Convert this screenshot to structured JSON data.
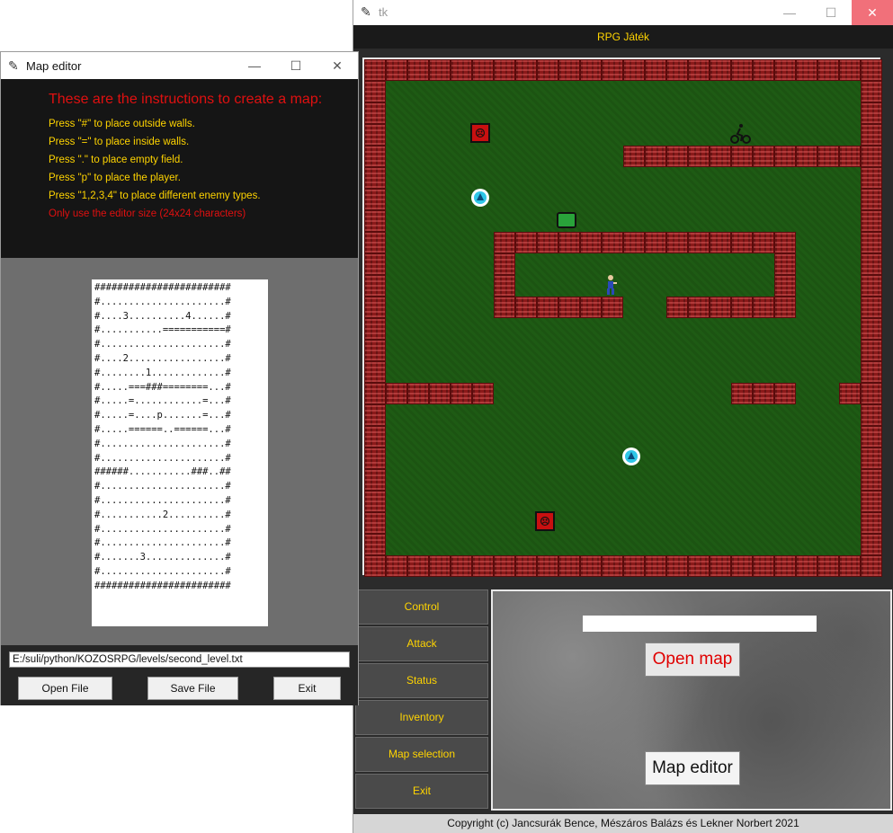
{
  "main_window": {
    "title": "tk",
    "minimize": "—",
    "maximize": "☐",
    "close": "✕",
    "header": "RPG Játék",
    "side_menu": [
      "Control",
      "Attack",
      "Status",
      "Inventory",
      "Map selection",
      "Exit"
    ],
    "open_map_label": "Open map",
    "map_editor_label": "Map editor",
    "map_name_value": "",
    "copyright": "Copyright (c) Jancsurák Bence, Mészáros Balázs és Lekner Norbert 2021",
    "colors": {
      "accent_yellow": "#ffd400",
      "wall": "#8b1a1a",
      "field": "#1e5b14",
      "open_map_text": "#e00000"
    }
  },
  "editor_window": {
    "title": "Map editor",
    "minimize": "—",
    "maximize": "☐",
    "close": "✕",
    "instructions_title": "These are the instructions to create a map:",
    "instructions": [
      "Press \"#\"  to place outside walls.",
      "Press \"=\"   to place inside walls.",
      "Press \".\"   to place empty field.",
      "Press \"p\"   to place the player.",
      "Press \"1,2,3,4\" to place different enemy types."
    ],
    "warning": "Only use the editor size (24x24 characters)",
    "map_lines": [
      "########################",
      "#......................#",
      "#....3..........4......#",
      "#...........===========#",
      "#......................#",
      "#....2.................#",
      "#........1.............#",
      "#.....===###========...#",
      "#.....=............=...#",
      "#.....=....p.......=...#",
      "#.....======..======...#",
      "#......................#",
      "#......................#",
      "######...........###..##",
      "#......................#",
      "#......................#",
      "#...........2..........#",
      "#......................#",
      "#......................#",
      "#.......3..............#",
      "#......................#",
      "########################"
    ],
    "file_path": "E:/suli/python/KOZOSRPG/levels/second_level.txt",
    "open_file_label": "Open File",
    "save_file_label": "Save File",
    "exit_label": "Exit"
  }
}
